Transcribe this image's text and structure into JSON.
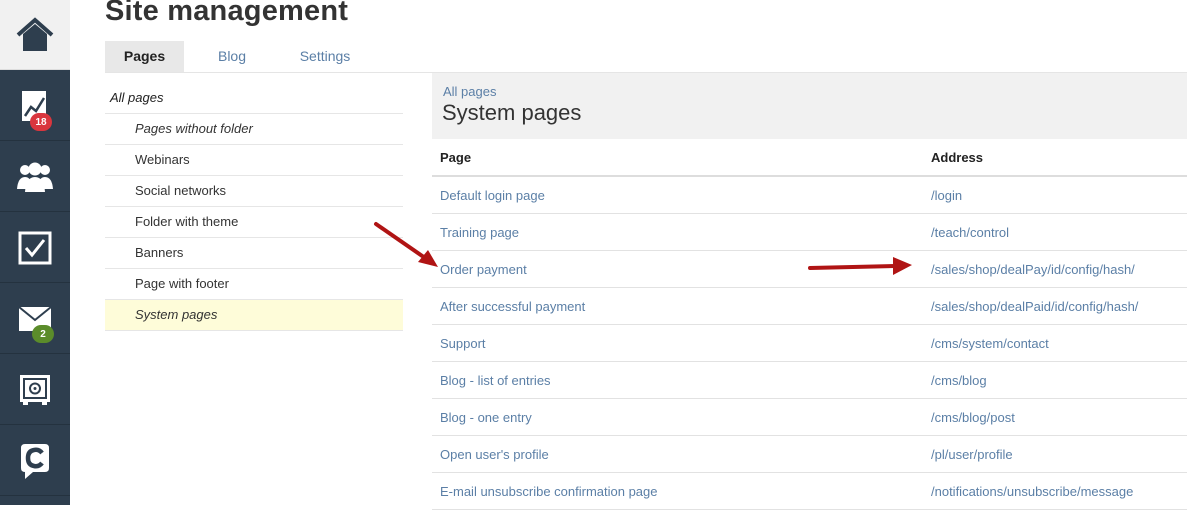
{
  "rail": {
    "items": [
      {
        "icon": "home-icon"
      },
      {
        "icon": "chart-icon",
        "badge": "18",
        "badge_color": "#d9363e"
      },
      {
        "icon": "users-icon"
      },
      {
        "icon": "checkbox-icon"
      },
      {
        "icon": "mail-icon",
        "badge": "2",
        "badge_color": "#5b8c2a"
      },
      {
        "icon": "safe-icon"
      },
      {
        "icon": "logo-icon"
      }
    ]
  },
  "header": {
    "title": "Site management"
  },
  "tabs": [
    {
      "label": "Pages",
      "active": true
    },
    {
      "label": "Blog",
      "active": false
    },
    {
      "label": "Settings",
      "active": false
    }
  ],
  "tree": {
    "root": "All pages",
    "items": [
      {
        "label": "Pages without folder"
      },
      {
        "label": "Webinars"
      },
      {
        "label": "Social networks"
      },
      {
        "label": "Folder with theme"
      },
      {
        "label": "Banners"
      },
      {
        "label": "Page with footer"
      },
      {
        "label": "System pages",
        "selected": true
      }
    ]
  },
  "main": {
    "breadcrumb": "All pages",
    "title": "System pages",
    "columns": [
      "Page",
      "Address"
    ],
    "rows": [
      {
        "page": "Default login page",
        "address": "/login"
      },
      {
        "page": "Training page",
        "address": "/teach/control"
      },
      {
        "page": "Order payment",
        "address": "/sales/shop/dealPay/id/config/hash/"
      },
      {
        "page": "After successful payment",
        "address": "/sales/shop/dealPaid/id/config/hash/"
      },
      {
        "page": "Support",
        "address": "/cms/system/contact"
      },
      {
        "page": "Blog - list of entries",
        "address": "/cms/blog"
      },
      {
        "page": "Blog - one entry",
        "address": "/cms/blog/post"
      },
      {
        "page": "Open user's profile",
        "address": "/pl/user/profile"
      },
      {
        "page": "E-mail unsubscribe confirmation page",
        "address": "/notifications/unsubscribe/message"
      }
    ]
  },
  "colors": {
    "accent_link": "#5b7fa6",
    "rail_bg": "#2e3e4e",
    "annotation_arrow": "#b01414",
    "selected_bg": "#fefcd9"
  }
}
